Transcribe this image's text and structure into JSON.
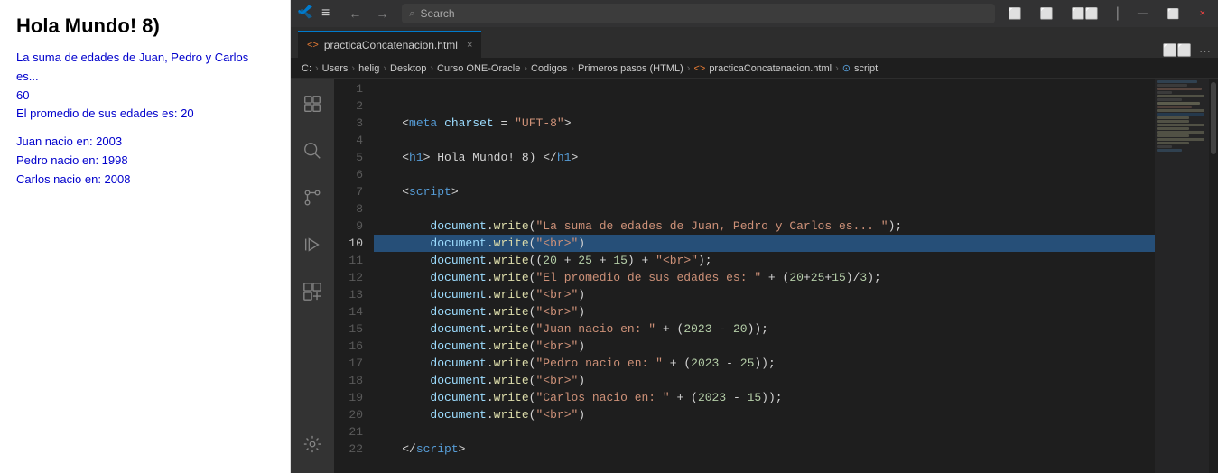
{
  "browser": {
    "title": "Hola Mundo! 8)",
    "output_lines": [
      {
        "text": "La suma de edades de Juan, Pedro y Carlos es...",
        "color": "blue"
      },
      {
        "text": "60",
        "color": "blue"
      },
      {
        "text": "El promedio de sus edades es: 20",
        "color": "blue"
      }
    ],
    "spacer": true,
    "birth_lines": [
      {
        "text": "Juan nacio en: 2003",
        "color": "blue"
      },
      {
        "text": "Pedro nacio en: 1998",
        "color": "blue"
      },
      {
        "text": "Carlos nacio en: 2008",
        "color": "blue"
      }
    ]
  },
  "vscode": {
    "title_icon": "VS",
    "menu_icon": "☰",
    "nav_back": "←",
    "nav_forward": "→",
    "search_placeholder": "Search",
    "tab": {
      "icon": "<>",
      "label": "practicaConcatenacion.html",
      "close": "×"
    },
    "breadcrumb": "C: › Users › helig › Desktop › Curso ONE-Oracle › Codigos › Primeros pasos (HTML) › <> practicaConcatenacion.html › ⊙ script",
    "layout_icons": [
      "⬜",
      "⬜",
      "⬜⬜"
    ],
    "window_controls": [
      "—",
      "⬜",
      "×"
    ],
    "activity_items": [
      {
        "icon": "❐",
        "name": "explorer",
        "active": false
      },
      {
        "icon": "🔍",
        "name": "search",
        "active": false
      },
      {
        "icon": "⑂",
        "name": "source-control",
        "active": false
      },
      {
        "icon": "▷",
        "name": "run",
        "active": false
      },
      {
        "icon": "⊞",
        "name": "extensions",
        "active": false
      },
      {
        "icon": "⚙",
        "name": "settings",
        "active": false,
        "bottom": true
      }
    ],
    "code_lines": [
      {
        "num": 1,
        "content": "",
        "active": false
      },
      {
        "num": 2,
        "content": "",
        "active": false
      },
      {
        "num": 3,
        "content": "",
        "active": false
      },
      {
        "num": 4,
        "content": "",
        "active": false
      },
      {
        "num": 5,
        "content": "",
        "active": false
      },
      {
        "num": 6,
        "content": "",
        "active": false
      },
      {
        "num": 7,
        "content": "",
        "active": false
      },
      {
        "num": 8,
        "content": "",
        "active": false
      },
      {
        "num": 9,
        "content": "",
        "active": false
      },
      {
        "num": 10,
        "content": "",
        "active": true
      },
      {
        "num": 11,
        "content": "",
        "active": false
      },
      {
        "num": 12,
        "content": "",
        "active": false
      },
      {
        "num": 13,
        "content": "",
        "active": false
      },
      {
        "num": 14,
        "content": "",
        "active": false
      },
      {
        "num": 15,
        "content": "",
        "active": false
      },
      {
        "num": 16,
        "content": "",
        "active": false
      },
      {
        "num": 17,
        "content": "",
        "active": false
      },
      {
        "num": 18,
        "content": "",
        "active": false
      },
      {
        "num": 19,
        "content": "",
        "active": false
      },
      {
        "num": 20,
        "content": "",
        "active": false
      },
      {
        "num": 21,
        "content": "",
        "active": false
      },
      {
        "num": 22,
        "content": "",
        "active": false
      }
    ]
  }
}
